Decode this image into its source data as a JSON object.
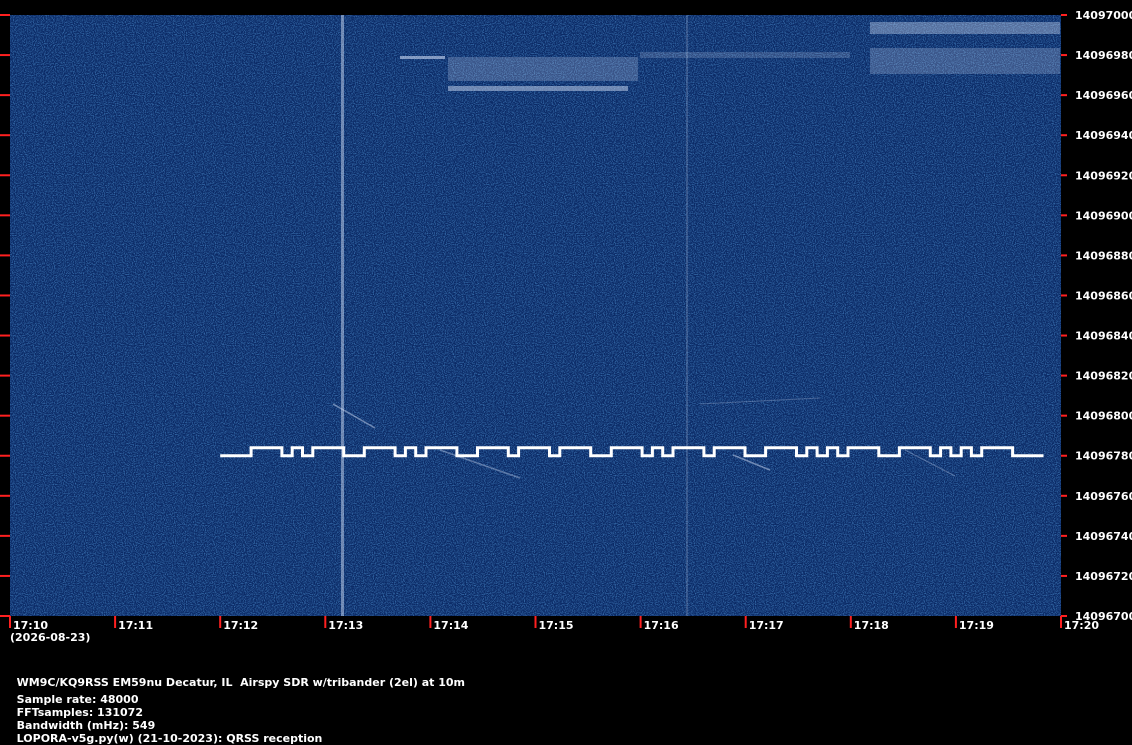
{
  "chart_data": {
    "type": "heatmap",
    "title": "",
    "xlabel": "",
    "ylabel": "",
    "x_ticks": [
      "17:10",
      "17:11",
      "17:12",
      "17:13",
      "17:14",
      "17:15",
      "17:16",
      "17:17",
      "17:18",
      "17:19",
      "17:20"
    ],
    "x_range": [
      "17:10",
      "17:20"
    ],
    "date_label": "(2026-08-23)",
    "y_ticks": [
      14096700,
      14096720,
      14096740,
      14096760,
      14096780,
      14096800,
      14096820,
      14096840,
      14096860,
      14096880,
      14096900,
      14096920,
      14096940,
      14096960,
      14096980,
      14097000
    ],
    "ylim": [
      14096700,
      14097000
    ],
    "colors": {
      "background": "#0b2a66",
      "signal": "#dfeaff",
      "tick": "#ff2020",
      "trace": "#ffffff"
    },
    "trace": {
      "start": "17:12",
      "end": "17:19:50",
      "low_hz": 14096780,
      "high_hz": 14096784,
      "pattern": [
        0,
        0,
        0,
        1,
        1,
        1,
        0,
        1,
        0,
        1,
        1,
        1,
        0,
        0,
        1,
        1,
        1,
        0,
        1,
        0,
        1,
        1,
        1,
        0,
        0,
        1,
        1,
        1,
        0,
        1,
        1,
        1,
        0,
        1,
        1,
        1,
        0,
        0,
        1,
        1,
        1,
        0,
        1,
        0,
        1,
        1,
        1,
        0,
        1,
        1,
        1,
        0,
        0,
        1,
        1,
        1,
        0,
        1,
        0,
        1,
        0,
        1,
        1,
        1,
        0,
        0,
        1,
        1,
        1,
        0,
        1,
        0,
        1,
        0,
        1,
        1,
        1,
        0,
        0,
        0
      ]
    }
  },
  "footer": {
    "station": "WM9C/KQ9RSS EM59nu Decatur, IL  Airspy SDR w/tribander (2el) at 10m",
    "sample_rate": "Sample rate: 48000",
    "fft_samples": "FFTsamples: 131072",
    "bandwidth": "Bandwidth (mHz): 549",
    "software": "LOPORA-v5g.py(w) (21-10-2023): QRSS reception"
  }
}
